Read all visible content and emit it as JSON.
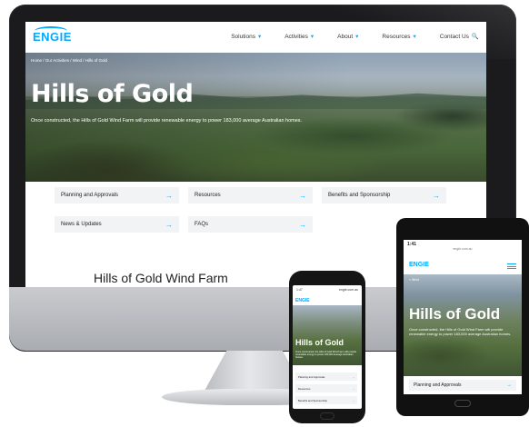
{
  "desktop": {
    "logo": "ENGIE",
    "menu": [
      {
        "label": "Solutions",
        "chevron": "▾"
      },
      {
        "label": "Activities",
        "chevron": "▾"
      },
      {
        "label": "About",
        "chevron": "▾"
      },
      {
        "label": "Resources",
        "chevron": "▾"
      },
      {
        "label": "Contact Us",
        "chevron": "🔍"
      }
    ],
    "breadcrumb": "Home / Our Activities / Wind / Hills of Gold",
    "hero_title": "Hills of Gold",
    "hero_subtitle": "Once constructed, the Hills of Gold Wind Farm will provide renewable energy to power 183,000 average Australian homes.",
    "links": [
      "Planning and Approvals",
      "Resources",
      "Benefits and Sponsorship",
      "News & Updates",
      "FAQs"
    ],
    "section_title": "Hills of Gold Wind Farm"
  },
  "phone": {
    "time": "1:47",
    "url": "engie.com.au",
    "logo": "ENGIE",
    "hero_title": "Hills of Gold",
    "hero_subtitle": "Once constructed, the Hills of Gold Wind Farm will provide renewable energy to power 183,000 average Australian homes.",
    "rows": [
      "Planning and Approvals",
      "Resources",
      "Benefits and Sponsorship"
    ]
  },
  "tablet": {
    "time": "1:41",
    "url": "engie.com.au",
    "logo": "ENGIE",
    "breadcrumb": "< Wind",
    "hero_title": "Hills of Gold",
    "hero_subtitle": "Once constructed, the Hills of Gold Wind Farm will provide renewable energy to power 183,000 average Australian homes.",
    "row": "Planning and Approvals"
  },
  "arrow": "→",
  "colors": {
    "accent": "#00aaff",
    "frame": "#1b1b1d",
    "tile": "#f2f3f5"
  }
}
